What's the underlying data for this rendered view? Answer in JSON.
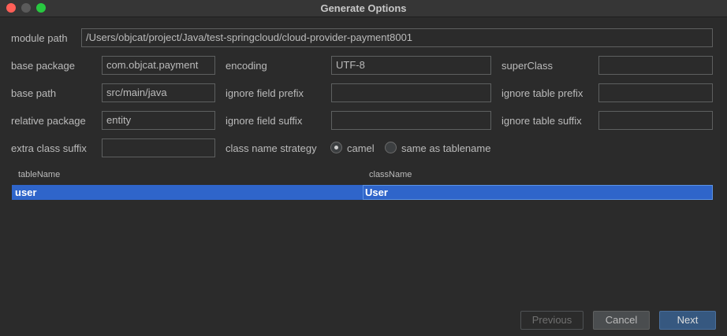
{
  "window": {
    "title": "Generate Options"
  },
  "form": {
    "module_path": {
      "label": "module path",
      "value": "/Users/objcat/project/Java/test-springcloud/cloud-provider-payment8001"
    },
    "base_package": {
      "label": "base package",
      "value": "com.objcat.payment"
    },
    "encoding": {
      "label": "encoding",
      "value": "UTF-8"
    },
    "super_class": {
      "label": "superClass",
      "value": ""
    },
    "base_path": {
      "label": "base path",
      "value": "src/main/java"
    },
    "ignore_field_prefix": {
      "label": "ignore field prefix",
      "value": ""
    },
    "ignore_table_prefix": {
      "label": "ignore table prefix",
      "value": ""
    },
    "relative_package": {
      "label": "relative package",
      "value": "entity"
    },
    "ignore_field_suffix": {
      "label": "ignore field suffix",
      "value": ""
    },
    "ignore_table_suffix": {
      "label": "ignore table suffix",
      "value": ""
    },
    "extra_class_suffix": {
      "label": "extra class suffix",
      "value": ""
    },
    "class_name_strategy": {
      "label": "class name strategy",
      "options": [
        {
          "label": "camel",
          "checked": true
        },
        {
          "label": "same as tablename",
          "checked": false
        }
      ]
    }
  },
  "table": {
    "columns": [
      "tableName",
      "className"
    ],
    "rows": [
      {
        "tableName": "user",
        "className": "User"
      }
    ]
  },
  "buttons": {
    "previous": "Previous",
    "cancel": "Cancel",
    "next": "Next"
  }
}
